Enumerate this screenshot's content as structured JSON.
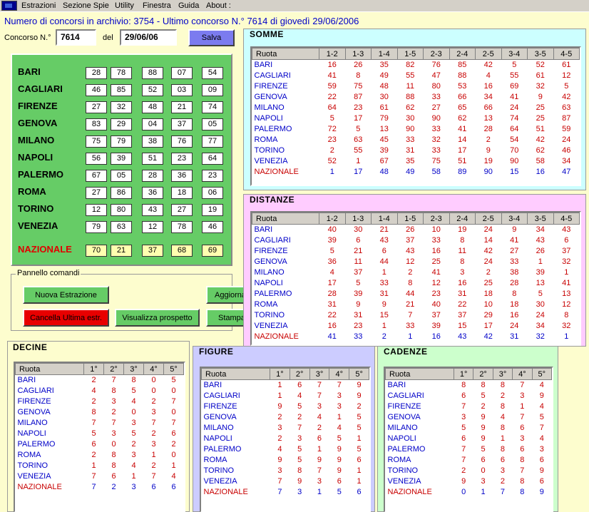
{
  "menu": [
    "Estrazioni",
    "Sezione Spie",
    "Utility",
    "Finestra",
    "Guida",
    "About :"
  ],
  "info": "Numero di concorsi in archivio: 3754   -   Ultimo concorso N.° 7614   di giovedì 29/06/2006",
  "concorso": {
    "label": "Concorso N.°",
    "value": "7614",
    "del_label": "del",
    "date": "29/06/06",
    "save_label": "Salva"
  },
  "cities": [
    "BARI",
    "CAGLIARI",
    "FIRENZE",
    "GENOVA",
    "MILANO",
    "NAPOLI",
    "PALERMO",
    "ROMA",
    "TORINO",
    "VENEZIA"
  ],
  "national_label": "NAZIONALE",
  "draws": [
    [
      "28",
      "78",
      "88",
      "07",
      "54"
    ],
    [
      "46",
      "85",
      "52",
      "03",
      "09"
    ],
    [
      "27",
      "32",
      "48",
      "21",
      "74"
    ],
    [
      "83",
      "29",
      "04",
      "37",
      "05"
    ],
    [
      "75",
      "79",
      "38",
      "76",
      "77"
    ],
    [
      "56",
      "39",
      "51",
      "23",
      "64"
    ],
    [
      "67",
      "05",
      "28",
      "36",
      "23"
    ],
    [
      "27",
      "86",
      "36",
      "18",
      "06"
    ],
    [
      "12",
      "80",
      "43",
      "27",
      "19"
    ],
    [
      "79",
      "63",
      "12",
      "78",
      "46"
    ]
  ],
  "national_draw": [
    "70",
    "21",
    "37",
    "68",
    "69"
  ],
  "commands": {
    "group_label": "Pannello comandi",
    "nuova": "Nuova Estrazione",
    "aggiorna": "Aggiorna",
    "cancella": "Cancella Ultima estr.",
    "visualizza": "Visualizza prospetto",
    "stampa": "Stampa"
  },
  "colors": {
    "background": "#fdfdce",
    "draw_panel": "#66cc66",
    "somme": "#ccffff",
    "distanze": "#ffccff",
    "decine": "#fdfdce",
    "figure": "#ccccff",
    "cadenze": "#ccffcc"
  },
  "somme": {
    "title": "SOMME",
    "headers": [
      "Ruota",
      "1-2",
      "1-3",
      "1-4",
      "1-5",
      "2-3",
      "2-4",
      "2-5",
      "3-4",
      "3-5",
      "4-5"
    ],
    "rows": [
      [
        "BARI",
        "16",
        "26",
        "35",
        "82",
        "76",
        "85",
        "42",
        "5",
        "52",
        "61"
      ],
      [
        "CAGLIARI",
        "41",
        "8",
        "49",
        "55",
        "47",
        "88",
        "4",
        "55",
        "61",
        "12"
      ],
      [
        "FIRENZE",
        "59",
        "75",
        "48",
        "11",
        "80",
        "53",
        "16",
        "69",
        "32",
        "5"
      ],
      [
        "GENOVA",
        "22",
        "87",
        "30",
        "88",
        "33",
        "66",
        "34",
        "41",
        "9",
        "42"
      ],
      [
        "MILANO",
        "64",
        "23",
        "61",
        "62",
        "27",
        "65",
        "66",
        "24",
        "25",
        "63"
      ],
      [
        "NAPOLI",
        "5",
        "17",
        "79",
        "30",
        "90",
        "62",
        "13",
        "74",
        "25",
        "87"
      ],
      [
        "PALERMO",
        "72",
        "5",
        "13",
        "90",
        "33",
        "41",
        "28",
        "64",
        "51",
        "59"
      ],
      [
        "ROMA",
        "23",
        "63",
        "45",
        "33",
        "32",
        "14",
        "2",
        "54",
        "42",
        "24"
      ],
      [
        "TORINO",
        "2",
        "55",
        "39",
        "31",
        "33",
        "17",
        "9",
        "70",
        "62",
        "46"
      ],
      [
        "VENEZIA",
        "52",
        "1",
        "67",
        "35",
        "75",
        "51",
        "19",
        "90",
        "58",
        "34"
      ],
      [
        "NAZIONALE",
        "1",
        "17",
        "48",
        "49",
        "58",
        "89",
        "90",
        "15",
        "16",
        "47"
      ]
    ]
  },
  "distanze": {
    "title": "DISTANZE",
    "headers": [
      "Ruota",
      "1-2",
      "1-3",
      "1-4",
      "1-5",
      "2-3",
      "2-4",
      "2-5",
      "3-4",
      "3-5",
      "4-5"
    ],
    "rows": [
      [
        "BARI",
        "40",
        "30",
        "21",
        "26",
        "10",
        "19",
        "24",
        "9",
        "34",
        "43"
      ],
      [
        "CAGLIARI",
        "39",
        "6",
        "43",
        "37",
        "33",
        "8",
        "14",
        "41",
        "43",
        "6"
      ],
      [
        "FIRENZE",
        "5",
        "21",
        "6",
        "43",
        "16",
        "11",
        "42",
        "27",
        "26",
        "37"
      ],
      [
        "GENOVA",
        "36",
        "11",
        "44",
        "12",
        "25",
        "8",
        "24",
        "33",
        "1",
        "32"
      ],
      [
        "MILANO",
        "4",
        "37",
        "1",
        "2",
        "41",
        "3",
        "2",
        "38",
        "39",
        "1"
      ],
      [
        "NAPOLI",
        "17",
        "5",
        "33",
        "8",
        "12",
        "16",
        "25",
        "28",
        "13",
        "41"
      ],
      [
        "PALERMO",
        "28",
        "39",
        "31",
        "44",
        "23",
        "31",
        "18",
        "8",
        "5",
        "13"
      ],
      [
        "ROMA",
        "31",
        "9",
        "9",
        "21",
        "40",
        "22",
        "10",
        "18",
        "30",
        "12"
      ],
      [
        "TORINO",
        "22",
        "31",
        "15",
        "7",
        "37",
        "37",
        "29",
        "16",
        "24",
        "8"
      ],
      [
        "VENEZIA",
        "16",
        "23",
        "1",
        "33",
        "39",
        "15",
        "17",
        "24",
        "34",
        "32"
      ],
      [
        "NAZIONALE",
        "41",
        "33",
        "2",
        "1",
        "16",
        "43",
        "42",
        "31",
        "32",
        "1"
      ]
    ]
  },
  "decine": {
    "title": "DECINE",
    "headers": [
      "Ruota",
      "1°",
      "2°",
      "3°",
      "4°",
      "5°"
    ],
    "rows": [
      [
        "BARI",
        "2",
        "7",
        "8",
        "0",
        "5"
      ],
      [
        "CAGLIARI",
        "4",
        "8",
        "5",
        "0",
        "0"
      ],
      [
        "FIRENZE",
        "2",
        "3",
        "4",
        "2",
        "7"
      ],
      [
        "GENOVA",
        "8",
        "2",
        "0",
        "3",
        "0"
      ],
      [
        "MILANO",
        "7",
        "7",
        "3",
        "7",
        "7"
      ],
      [
        "NAPOLI",
        "5",
        "3",
        "5",
        "2",
        "6"
      ],
      [
        "PALERMO",
        "6",
        "0",
        "2",
        "3",
        "2"
      ],
      [
        "ROMA",
        "2",
        "8",
        "3",
        "1",
        "0"
      ],
      [
        "TORINO",
        "1",
        "8",
        "4",
        "2",
        "1"
      ],
      [
        "VENEZIA",
        "7",
        "6",
        "1",
        "7",
        "4"
      ],
      [
        "NAZIONALE",
        "7",
        "2",
        "3",
        "6",
        "6"
      ]
    ]
  },
  "figure": {
    "title": "FIGURE",
    "headers": [
      "Ruota",
      "1°",
      "2°",
      "3°",
      "4°",
      "5°"
    ],
    "rows": [
      [
        "BARI",
        "1",
        "6",
        "7",
        "7",
        "9"
      ],
      [
        "CAGLIARI",
        "1",
        "4",
        "7",
        "3",
        "9"
      ],
      [
        "FIRENZE",
        "9",
        "5",
        "3",
        "3",
        "2"
      ],
      [
        "GENOVA",
        "2",
        "2",
        "4",
        "1",
        "5"
      ],
      [
        "MILANO",
        "3",
        "7",
        "2",
        "4",
        "5"
      ],
      [
        "NAPOLI",
        "2",
        "3",
        "6",
        "5",
        "1"
      ],
      [
        "PALERMO",
        "4",
        "5",
        "1",
        "9",
        "5"
      ],
      [
        "ROMA",
        "9",
        "5",
        "9",
        "9",
        "6"
      ],
      [
        "TORINO",
        "3",
        "8",
        "7",
        "9",
        "1"
      ],
      [
        "VENEZIA",
        "7",
        "9",
        "3",
        "6",
        "1"
      ],
      [
        "NAZIONALE",
        "7",
        "3",
        "1",
        "5",
        "6"
      ]
    ]
  },
  "cadenze": {
    "title": "CADENZE",
    "headers": [
      "Ruota",
      "1°",
      "2°",
      "3°",
      "4°",
      "5°"
    ],
    "rows": [
      [
        "BARI",
        "8",
        "8",
        "8",
        "7",
        "4"
      ],
      [
        "CAGLIARI",
        "6",
        "5",
        "2",
        "3",
        "9"
      ],
      [
        "FIRENZE",
        "7",
        "2",
        "8",
        "1",
        "4"
      ],
      [
        "GENOVA",
        "3",
        "9",
        "4",
        "7",
        "5"
      ],
      [
        "MILANO",
        "5",
        "9",
        "8",
        "6",
        "7"
      ],
      [
        "NAPOLI",
        "6",
        "9",
        "1",
        "3",
        "4"
      ],
      [
        "PALERMO",
        "7",
        "5",
        "8",
        "6",
        "3"
      ],
      [
        "ROMA",
        "7",
        "6",
        "6",
        "8",
        "6"
      ],
      [
        "TORINO",
        "2",
        "0",
        "3",
        "7",
        "9"
      ],
      [
        "VENEZIA",
        "9",
        "3",
        "2",
        "8",
        "6"
      ],
      [
        "NAZIONALE",
        "0",
        "1",
        "7",
        "8",
        "9"
      ]
    ]
  }
}
